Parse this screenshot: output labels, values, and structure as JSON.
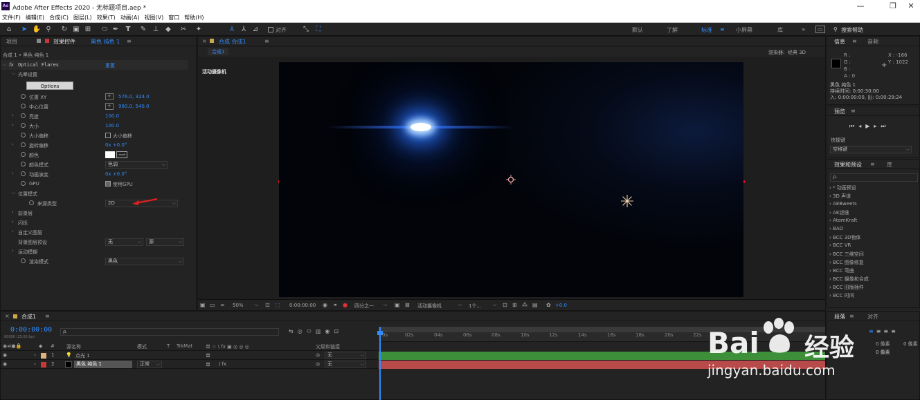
{
  "app": {
    "title": "Adobe After Effects 2020 - 无标题项目.aep *",
    "logo": "Ae"
  },
  "menu": [
    "文件(F)",
    "编辑(E)",
    "合成(C)",
    "图层(L)",
    "效果(T)",
    "动画(A)",
    "视图(V)",
    "窗口",
    "帮助(H)"
  ],
  "toolbar": {
    "align_label": "对齐",
    "workspaces": [
      "默认",
      "了解",
      "标准",
      "小屏幕",
      "库"
    ],
    "search_placeholder": "搜索帮助"
  },
  "left_panel": {
    "tabs": [
      "项目",
      "效果控件",
      "黑色 纯色 1"
    ],
    "subtitle": "合成 1 • 黑色 纯色 1",
    "effect_name": "Optical Flares",
    "reset": "重置",
    "section_options": "光晕设置",
    "options_button": "Options",
    "props": [
      {
        "label": "位置 XY",
        "value": "576.0, 324.0"
      },
      {
        "label": "中心位置",
        "value": "960.0, 540.0"
      },
      {
        "label": "亮度",
        "value": "100.0"
      },
      {
        "label": "大小",
        "value": "100.0"
      },
      {
        "label": "大小偏移",
        "value": "大小偏移"
      },
      {
        "label": "旋转偏移",
        "value": "0x +0.0°"
      },
      {
        "label": "颜色",
        "value": ""
      },
      {
        "label": "颜色模式",
        "value": "色调"
      },
      {
        "label": "动画演变",
        "value": "0x +0.0°"
      },
      {
        "label": "GPU",
        "value": "使用GPU"
      }
    ],
    "section_position": "位置模式",
    "source_type_label": "来源类型",
    "source_type_value": "2D",
    "sections": [
      "前景层",
      "闪烁",
      "自定义图层"
    ],
    "bg_label": "背景图层预设",
    "bg_value1": "无",
    "bg_value2": "源",
    "motion_blur": "运动模糊",
    "render_mode_label": "渲染模式",
    "render_mode_value": "黑色"
  },
  "comp_panel": {
    "tab": "合成 合成1",
    "sub_tab": "合成1",
    "renderer_label": "渲染器:",
    "renderer_value": "经典 3D",
    "camera_label": "活动摄像机",
    "zoom": "50%",
    "timecode": "0:00:00:00",
    "resolution": "四分之一",
    "camera": "活动摄像机",
    "views": "1个...",
    "exposure": "+0.0"
  },
  "right_panel": {
    "info_tab": "信息",
    "audio_tab": "音频",
    "rgb": [
      "R :",
      "G :",
      "B :",
      "A : 0"
    ],
    "coords": [
      "X : -166",
      "Y : 1022"
    ],
    "layer_name": "黑色 纯色 1",
    "duration": "持续时间: 0:00:30:00",
    "in_out": "入: 0:00:00:00, 出: 0:00:29:24",
    "preview_tab": "预览",
    "shortcut_label": "快捷键",
    "shortcut_value": "空格键",
    "effects_tab": "效果和预设",
    "library_tab": "库",
    "search_placeholder": "ρ.",
    "effects": [
      "* 动画预设",
      "3D 声道",
      "AEBweets",
      "AE滤镜",
      "AtomKraft",
      "BAO",
      "BCC 3D物体",
      "BCC VR",
      "BCC 三维空间",
      "BCC 图像修复",
      "BCC 弯曲",
      "BCC 摄像和合成",
      "BCC 旧版插件",
      "BCC 时间"
    ],
    "paragraph_tab": "段落",
    "align_tab": "对齐",
    "px_values": [
      "0 像素",
      "0 像素",
      "0 像素",
      "0 像素"
    ]
  },
  "timeline": {
    "tab": "合成1",
    "timecode": "0:00:00:00",
    "frame_info": "00000 (25.00 fps)",
    "search_placeholder": "ρ.",
    "columns": {
      "name": "源名称",
      "mode": "模式",
      "t": "T",
      "trkmat": "TrkMat",
      "switches": "单 ☆ \\ fx ▣ ◎ ◎ ◎",
      "parent": "父级和链接"
    },
    "ruler": [
      "0s",
      "02s",
      "04s",
      "06s",
      "08s",
      "10s",
      "12s",
      "14s",
      "16s",
      "18s",
      "20s",
      "22s"
    ],
    "layers": [
      {
        "num": "1",
        "name": "点光 1",
        "color": "#e0b080",
        "parent": "无",
        "mode": ""
      },
      {
        "num": "2",
        "name": "黑色 纯色 1",
        "color": "#c83838",
        "parent": "无",
        "mode": "正常"
      }
    ]
  },
  "watermark": {
    "brand": "Bai",
    "brand2": "经验",
    "url": "jingyan.baidu.com"
  }
}
